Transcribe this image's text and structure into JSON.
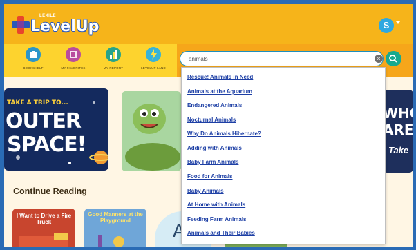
{
  "app": {
    "logo_kicker": "LEXILE",
    "logo_word": "LevelUp"
  },
  "user": {
    "initial": "S"
  },
  "nav": {
    "items": [
      {
        "label": "BOOKSHELF",
        "color": "#2b95c9"
      },
      {
        "label": "MY FAVORITES",
        "color": "#b94c9e"
      },
      {
        "label": "MY REPORT",
        "color": "#27a38a"
      },
      {
        "label": "LEVELUP LAND",
        "color": "#37b3d8"
      }
    ]
  },
  "search": {
    "value": "animals",
    "placeholder": ""
  },
  "suggestions": [
    "Rescue! Animals in Need",
    "Animals at the Aquarium",
    "Endangered Animals",
    "Nocturnal Animals",
    "Why Do Animals Hibernate?",
    "Adding with Animals",
    "Baby Farm Animals",
    "Food for Animals",
    "Baby Animals",
    "At Home with Animals",
    "Feeding Farm Animals",
    "Animals and Their Babies"
  ],
  "featured": {
    "space_line1": "TAKE A TRIP TO...",
    "space_line2": "OUTER",
    "space_line3": "SPACE!",
    "partial_line1": "WHOS",
    "partial_line2": "ARE T",
    "partial_line3": "Take"
  },
  "continue_reading": {
    "title": "Continue Reading",
    "books": [
      {
        "title": "I Want to Drive a Fire Truck"
      },
      {
        "title": "Good Manners at the Playground"
      },
      {
        "title": "Aa"
      }
    ]
  },
  "colors": {
    "header": "#f6b41a",
    "nav": "#fdd32e",
    "accent": "#1d8fbe",
    "link": "#1d3fa5"
  }
}
